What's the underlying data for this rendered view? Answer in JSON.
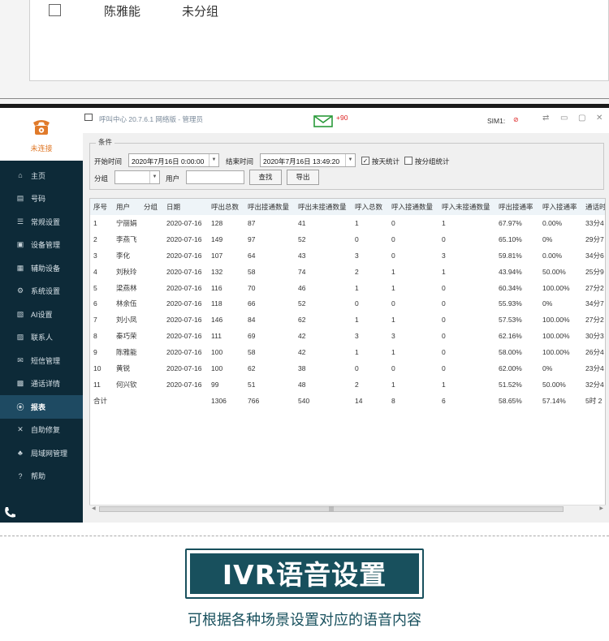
{
  "top_fragment": {
    "name": "陈雅能",
    "group": "未分组"
  },
  "app": {
    "title": "呼叫中心 20.7.6.1 网络版 - 管理员",
    "status": "未连接",
    "mail_badge": "+90",
    "sim_label": "SIM1:",
    "icons": [
      "phone-icon",
      "menu-icon",
      "mail-icon",
      "sim-blocked-icon",
      "swap-icon",
      "minimize-icon",
      "maximize-icon",
      "close-icon"
    ]
  },
  "sidebar": {
    "items": [
      {
        "icon": "⌂",
        "label": "主页"
      },
      {
        "icon": "▤",
        "label": "号码"
      },
      {
        "icon": "☰",
        "label": "常规设置"
      },
      {
        "icon": "▣",
        "label": "设备管理"
      },
      {
        "icon": "▦",
        "label": "辅助设备"
      },
      {
        "icon": "⚙",
        "label": "系统设置"
      },
      {
        "icon": "▧",
        "label": "AI设置"
      },
      {
        "icon": "▨",
        "label": "联系人"
      },
      {
        "icon": "✉",
        "label": "短信管理"
      },
      {
        "icon": "▩",
        "label": "通话详情"
      },
      {
        "icon": "⦿",
        "label": "报表"
      },
      {
        "icon": "✕",
        "label": "自助修复"
      },
      {
        "icon": "♣",
        "label": "局域网管理"
      },
      {
        "icon": "?",
        "label": "帮助"
      }
    ],
    "active_index": 10
  },
  "conditions": {
    "title": "条件",
    "start_label": "开始时间",
    "start_value": "2020年7月16日 0:00:00",
    "end_label": "结束时间",
    "end_value": "2020年7月16日 13:49:20",
    "by_day_label": "按天统计",
    "by_day_checked": true,
    "by_group_label": "按分组统计",
    "by_group_checked": false,
    "group_label": "分组",
    "group_value": "",
    "user_label": "用户",
    "user_value": "",
    "search_button": "查找",
    "export_button": "导出"
  },
  "table": {
    "columns": [
      "序号",
      "用户",
      "分组",
      "日期",
      "呼出总数",
      "呼出接通数量",
      "呼出未接通数量",
      "呼入总数",
      "呼入接通数量",
      "呼入未接通数量",
      "呼出接通率",
      "呼入接通率",
      "通话时长"
    ],
    "rows": [
      [
        "1",
        "宁丽娟",
        "",
        "2020-07-16",
        "128",
        "87",
        "41",
        "1",
        "0",
        "1",
        "67.97%",
        "0.00%",
        "33分4"
      ],
      [
        "2",
        "李燕飞",
        "",
        "2020-07-16",
        "149",
        "97",
        "52",
        "0",
        "0",
        "0",
        "65.10%",
        "0%",
        "29分7"
      ],
      [
        "3",
        "李化",
        "",
        "2020-07-16",
        "107",
        "64",
        "43",
        "3",
        "0",
        "3",
        "59.81%",
        "0.00%",
        "34分6"
      ],
      [
        "4",
        "刘秋玲",
        "",
        "2020-07-16",
        "132",
        "58",
        "74",
        "2",
        "1",
        "1",
        "43.94%",
        "50.00%",
        "25分9"
      ],
      [
        "5",
        "梁燕林",
        "",
        "2020-07-16",
        "116",
        "70",
        "46",
        "1",
        "1",
        "0",
        "60.34%",
        "100.00%",
        "27分2"
      ],
      [
        "6",
        "林余伍",
        "",
        "2020-07-16",
        "118",
        "66",
        "52",
        "0",
        "0",
        "0",
        "55.93%",
        "0%",
        "34分7"
      ],
      [
        "7",
        "刘小凤",
        "",
        "2020-07-16",
        "146",
        "84",
        "62",
        "1",
        "1",
        "0",
        "57.53%",
        "100.00%",
        "27分2"
      ],
      [
        "8",
        "秦巧荣",
        "",
        "2020-07-16",
        "111",
        "69",
        "42",
        "3",
        "3",
        "0",
        "62.16%",
        "100.00%",
        "30分3"
      ],
      [
        "9",
        "陈雅能",
        "",
        "2020-07-16",
        "100",
        "58",
        "42",
        "1",
        "1",
        "0",
        "58.00%",
        "100.00%",
        "26分4"
      ],
      [
        "10",
        "黄锐",
        "",
        "2020-07-16",
        "100",
        "62",
        "38",
        "0",
        "0",
        "0",
        "62.00%",
        "0%",
        "23分4"
      ],
      [
        "11",
        "何兴钦",
        "",
        "2020-07-16",
        "99",
        "51",
        "48",
        "2",
        "1",
        "1",
        "51.52%",
        "50.00%",
        "32分4"
      ]
    ],
    "total_row": [
      "合计",
      "",
      "",
      "",
      "1306",
      "766",
      "540",
      "14",
      "8",
      "6",
      "58.65%",
      "57.14%",
      "5时 2"
    ]
  },
  "footer": {
    "headline": "IVR语音设置",
    "subline": "可根据各种场景设置对应的语音内容"
  }
}
